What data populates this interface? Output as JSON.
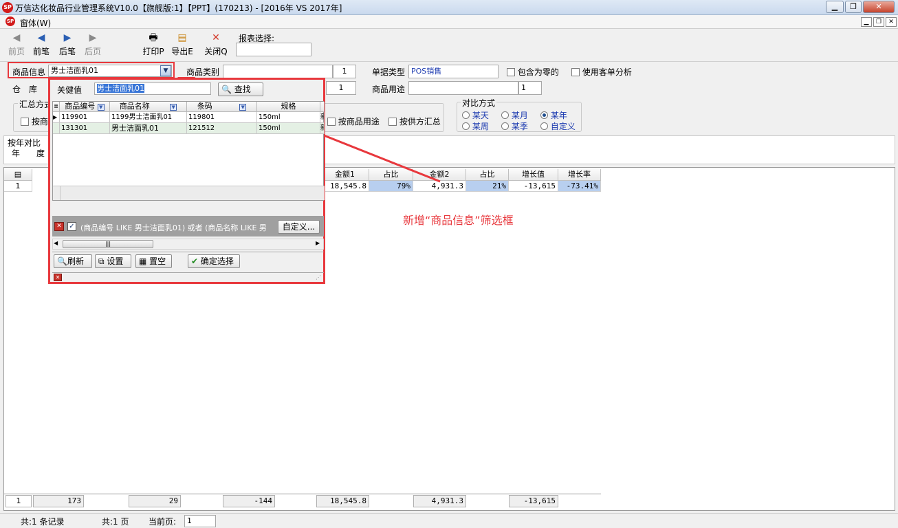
{
  "window": {
    "title": "万信达化妆品行业管理系统V10.0【旗舰版:1】【PPT】(170213) - [2016年 VS 2017年]",
    "logo_text": "SP"
  },
  "menubar": {
    "items": [
      {
        "label": "窗体(W)"
      }
    ]
  },
  "toolbar": {
    "buttons": [
      {
        "label": "前页",
        "icon": "first-page-icon",
        "enabled": false
      },
      {
        "label": "前笔",
        "icon": "prev-record-icon",
        "enabled": true
      },
      {
        "label": "后笔",
        "icon": "next-record-icon",
        "enabled": true
      },
      {
        "label": "后页",
        "icon": "last-page-icon",
        "enabled": false
      },
      {
        "label": "打印P",
        "icon": "printer-icon",
        "enabled": true
      },
      {
        "label": "导出E",
        "icon": "export-icon",
        "enabled": true
      },
      {
        "label": "关闭Q",
        "icon": "close-icon",
        "enabled": true
      }
    ],
    "report_select_label": "报表选择:"
  },
  "filters": {
    "product_info_label": "商品信息",
    "product_info_value": "男士洁面乳01",
    "product_category_label": "商品类别",
    "product_category_num": "1",
    "doc_type_label": "单据类型",
    "doc_type_value": "POS销售",
    "include_zero_label": "包含为零的",
    "use_customer_analysis_label": "使用客单分析",
    "warehouse_label": "仓　库",
    "warehouse_num": "1",
    "product_use_label": "商品用途",
    "product_use_num": "1",
    "summary_method_label": "汇总方式",
    "by_product_label": "按商",
    "by_product_use_label": "按商品用途",
    "by_supplier_label": "按供方汇总",
    "compare_label": "对比方式",
    "compare_options": [
      "某天",
      "某月",
      "某年",
      "某周",
      "某季",
      "自定义"
    ],
    "compare_selected": "某年",
    "yoy_label": "按年对比",
    "year_label": "年",
    "degree_label": "度"
  },
  "popup": {
    "keyword_label": "关健值",
    "keyword_value": "男士洁面乳01",
    "find_button": "查找",
    "columns": [
      "商品编号",
      "商品名称",
      "条码",
      "规格"
    ],
    "rows": [
      {
        "code": "119901",
        "name": "1199男士洁面乳01",
        "barcode": "119801",
        "spec": "150ml",
        "extra": "新"
      },
      {
        "code": "131301",
        "name": "男士洁面乳01",
        "barcode": "121512",
        "spec": "150ml",
        "extra": "新"
      }
    ],
    "filter_text": "(商品编号 LIKE 男士洁面乳01) 或者 (商品名称 LIKE 男",
    "custom_button": "自定义...",
    "refresh_button": "刷新",
    "settings_button": "设置",
    "clear_button": "置空",
    "confirm_button": "确定选择"
  },
  "grid": {
    "columns": [
      "金额1",
      "占比",
      "金额2",
      "占比",
      "增长值",
      "增长率"
    ],
    "row_index": "1",
    "row": [
      "18,545.8",
      "79%",
      "4,931.3",
      "21%",
      "-13,615",
      "-73.41%"
    ],
    "footer": {
      "index": "1",
      "values": [
        "173",
        "29",
        "-144",
        "18,545.8",
        "4,931.3",
        "-13,615"
      ]
    }
  },
  "annotation": "新增“商品信息”筛选框",
  "statusbar": {
    "records": "共:1 条记录",
    "pages": "共:1 页",
    "current_page_label": "当前页:",
    "current_page": "1"
  },
  "colors": {
    "highlight_red": "#e8383d",
    "cell_highlight": "#b8cfef"
  }
}
